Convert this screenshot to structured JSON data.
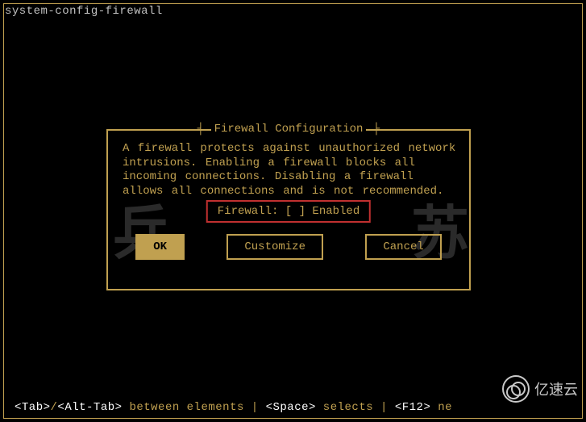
{
  "window": {
    "title": "system-config-firewall"
  },
  "dialog": {
    "title": "Firewall Configuration",
    "body": "A firewall protects against unauthorized network intrusions. Enabling a firewall blocks all incoming connections. Disabling a firewall allows all connections and is not recommended.",
    "checkbox": {
      "label": "Firewall:",
      "bracket_open": "[",
      "bracket_close": "]",
      "state_char": " ",
      "option_label": "Enabled"
    },
    "buttons": {
      "ok": "OK",
      "customize": "Customize",
      "cancel": "Cancel"
    }
  },
  "statusbar": {
    "left_prefix": "<Tab>",
    "left_sep": "/",
    "left_alt": "<Alt-Tab>",
    "left_text": " between elements",
    "pipe": "   |   ",
    "mid_key": "<Space>",
    "mid_text": " selects",
    "right_key": "<F12>",
    "right_text": " ne"
  },
  "watermark": {
    "text_left": "兵",
    "text_right": "苏",
    "brand": "亿速云"
  }
}
